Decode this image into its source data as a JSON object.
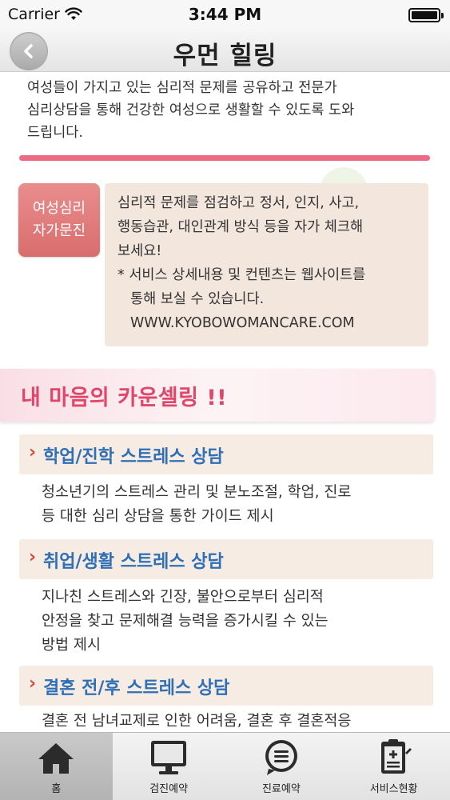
{
  "status_bar": {
    "carrier": "Carrier",
    "time": "3:44 PM"
  },
  "nav": {
    "title": "우먼 힐링"
  },
  "intro": {
    "lines": [
      "여성들이 가지고 있는 심리적 문제를 공유하고 전문가",
      "심리상담을 통해 건강한 여성으로 생활할 수 있도록 도와",
      "드립니다."
    ]
  },
  "self_check": {
    "badge_line1": "여성심리",
    "badge_line2": "자가문진",
    "desc_lines": [
      "심리적 문제를 점검하고 정서, 인지, 사고,",
      "행동습관, 대인관계 방식 등을 자가 체크해",
      "보세요!"
    ],
    "note_line1": "* 서비스 상세내용 및 컨텐츠는 웹사이트를",
    "note_line2": "통해 보실 수 있습니다.",
    "url": "WWW.KYOBOWOMANCARE.COM"
  },
  "counseling": {
    "banner_title": "내 마음의 카운셀링 !!",
    "sections": [
      {
        "chevron": "›",
        "title": "학업/진학 스트레스 상담",
        "desc_lines": [
          "청소년기의 스트레스 관리 및 분노조절, 학업, 진로",
          "등 대한 심리 상담을 통한 가이드 제시"
        ]
      },
      {
        "chevron": "›",
        "title": "취업/생활 스트레스 상담",
        "desc_lines": [
          "지나친 스트레스와 긴장, 불안으로부터 심리적",
          "안정을 찾고 문제해결 능력을 증가시킬 수 있는",
          "방법 제시"
        ]
      },
      {
        "chevron": "›",
        "title": "결혼 전/후 스트레스 상담",
        "desc_lines": [
          "결혼 전 남녀교제로 인한 어려움, 결혼 후 결혼적응"
        ]
      }
    ]
  },
  "tabs": [
    {
      "label": "홈",
      "icon": "home-icon"
    },
    {
      "label": "검진예약",
      "icon": "monitor-icon"
    },
    {
      "label": "진료예약",
      "icon": "chat-icon"
    },
    {
      "label": "서비스현황",
      "icon": "clipboard-icon"
    }
  ],
  "colors": {
    "accent_pink": "#ec6b84",
    "badge_red": "#d96d6d",
    "section_blue": "#2f6fb6",
    "banner_text": "#e0466a"
  }
}
